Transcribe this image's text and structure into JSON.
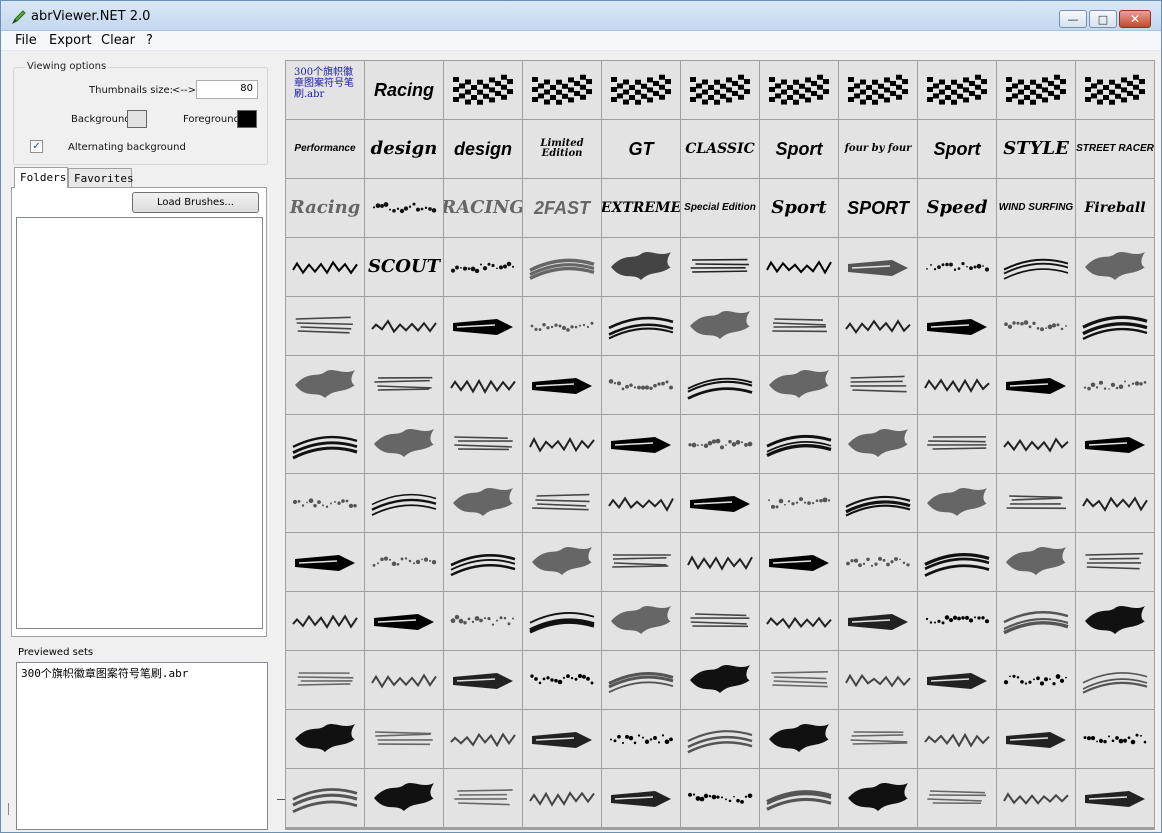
{
  "window": {
    "title": "abrViewer.NET 2.0",
    "min_glyph": "—",
    "max_glyph": "□",
    "close_glyph": "✕"
  },
  "menu": [
    "File",
    "Export",
    "Clear",
    "?"
  ],
  "viewing_options": {
    "legend": "Viewing options",
    "thumb_label": "Thumbnails size:",
    "thumb_arrow": "<-->",
    "thumb_value": "80",
    "background_label": "Background:",
    "background_color": "#e3e3e3",
    "foreground_label": "Foreground:",
    "foreground_color": "#000000",
    "alt_label": "Alternating background",
    "alt_checked": true
  },
  "tabs": [
    "Folders",
    "Favorites"
  ],
  "load_button": "Load Brushes...",
  "previewed": {
    "label": "Previewed sets",
    "items": [
      "300个旗帜徽章图案符号笔刷.abr"
    ]
  },
  "thumbnails": {
    "first_label": "300个旗帜徽章图案符号笔刷.abr",
    "text_labels": {
      "1": "Racing",
      "11": "Performance",
      "12": "design",
      "13": "design",
      "14": "Limited Edition",
      "15": "GT",
      "16": "CLASSIC",
      "17": "Sport",
      "18": "four by four",
      "19": "Sport",
      "20": "STYLE",
      "21": "STREET RACER",
      "22": "Racing",
      "24": "RACING",
      "25": "2FAST",
      "26": "EXTREME",
      "27": "Special Edition",
      "28": "Sport",
      "29": "SPORT",
      "30": "Speed",
      "31": "WIND SURFING",
      "32": "Fireball",
      "34": "SCOUT"
    }
  }
}
